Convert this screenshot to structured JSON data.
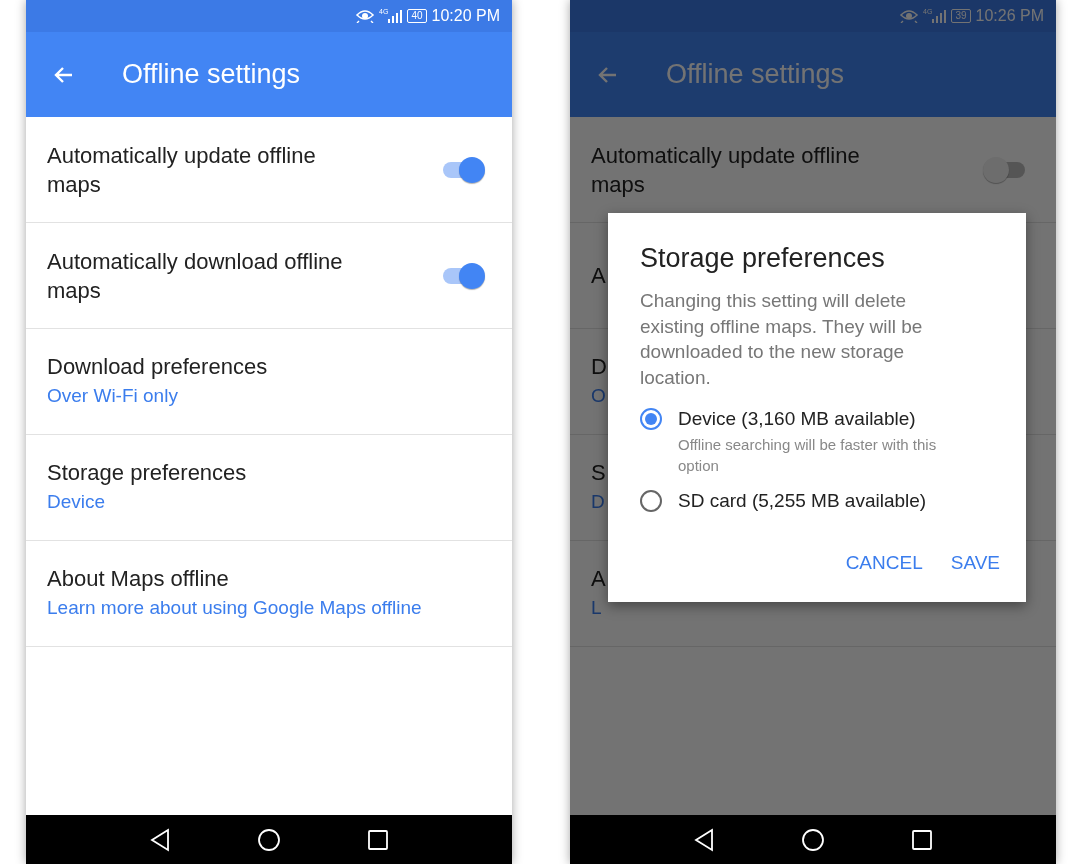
{
  "screens": [
    {
      "status_bar": {
        "network": "4G",
        "battery": "40",
        "time": "10:20 PM"
      },
      "app_bar": {
        "title": "Offline settings"
      },
      "dimmed": false,
      "settings": [
        {
          "kind": "toggle",
          "title": "Automatically update offline maps",
          "on": true
        },
        {
          "kind": "toggle",
          "title": "Automatically download offline maps",
          "on": true
        },
        {
          "kind": "link",
          "title": "Download preferences",
          "subtitle": "Over Wi-Fi only"
        },
        {
          "kind": "link",
          "title": "Storage preferences",
          "subtitle": "Device"
        },
        {
          "kind": "link",
          "title": "About Maps offline",
          "subtitle": "Learn more about using Google Maps offline"
        }
      ]
    },
    {
      "status_bar": {
        "network": "4G",
        "battery": "39",
        "time": "10:26 PM"
      },
      "app_bar": {
        "title": "Offline settings"
      },
      "dimmed": true,
      "settings": [
        {
          "kind": "toggle",
          "title": "Automatically update offline maps",
          "on": false
        },
        {
          "kind": "link",
          "title": "A"
        },
        {
          "kind": "link",
          "title": "D",
          "subtitle": "O"
        },
        {
          "kind": "link",
          "title": "S",
          "subtitle": "D"
        },
        {
          "kind": "link",
          "title": "A",
          "subtitle": "L"
        }
      ],
      "dialog": {
        "title": "Storage preferences",
        "message": "Changing this setting will delete existing offline maps. They will be downloaded to the new storage location.",
        "options": [
          {
            "label": "Device (3,160 MB available)",
            "detail": "Offline searching will be faster with this option",
            "selected": true
          },
          {
            "label": "SD card (5,255 MB available)",
            "selected": false
          }
        ],
        "buttons": [
          "CANCEL",
          "SAVE"
        ]
      }
    }
  ]
}
